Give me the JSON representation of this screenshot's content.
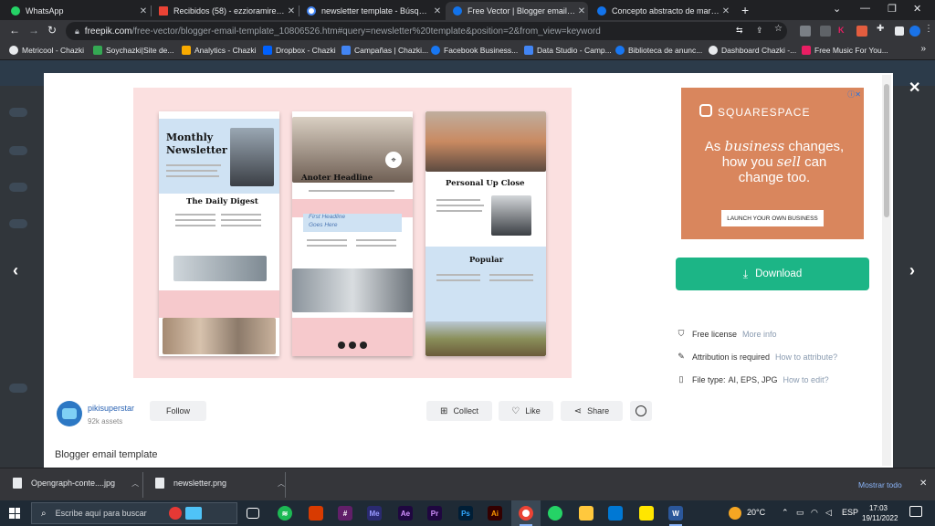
{
  "tabs": [
    {
      "label": "WhatsApp",
      "color": "#25d366"
    },
    {
      "label": "Recibidos (58) - ezzioramireza@g",
      "color": "#ea4335"
    },
    {
      "label": "newsletter template - Búsqueda",
      "color": "#4285f4"
    },
    {
      "label": "Free Vector | Blogger email temp",
      "color": "#1273eb"
    },
    {
      "label": "Concepto abstracto de marketing",
      "color": "#1273eb"
    }
  ],
  "omnibox": {
    "host": "freepik.com",
    "path": "/free-vector/blogger-email-template_10806526.htm#query=newsletter%20template&position=2&from_view=keyword"
  },
  "bookmarks": [
    {
      "label": "Metricool - Chazki",
      "color": "#e8eaed"
    },
    {
      "label": "Soychazki|Site de...",
      "color": "#34a853"
    },
    {
      "label": "Analytics - Chazki",
      "color": "#f9ab00"
    },
    {
      "label": "Dropbox - Chazki",
      "color": "#0061fe"
    },
    {
      "label": "Campañas | Chazki...",
      "color": "#4285f4"
    },
    {
      "label": "Facebook Business...",
      "color": "#1877f2"
    },
    {
      "label": "Data Studio - Camp...",
      "color": "#4285f4"
    },
    {
      "label": "Biblioteca de anunc...",
      "color": "#1877f2"
    },
    {
      "label": "Dashboard Chazki -...",
      "color": "#e8eaed"
    },
    {
      "label": "Free Music For You...",
      "color": "#e91e63"
    }
  ],
  "preview": {
    "panel1": {
      "title1": "Monthly",
      "title2": "Newsletter",
      "section": "The Daily Digest"
    },
    "panel2": {
      "headline": "Anoter Headline",
      "sub1": "First Headline",
      "sub2": "Goes Here"
    },
    "panel3": {
      "heading": "Personal Up Close",
      "section": "Popular"
    }
  },
  "ad": {
    "brand": "SQUARESPACE",
    "line1a": "As ",
    "line1b": "business",
    "line1c": " changes,",
    "line2a": "how you ",
    "line2b": "sell",
    "line2c": " can",
    "line3": "change too.",
    "cta": "LAUNCH YOUR OWN BUSINESS"
  },
  "download_label": "Download",
  "license": {
    "free": "Free license",
    "free_link": "More info",
    "attribution": "Attribution is required",
    "attribution_link": "How to attribute?",
    "filetype_label": "File type:",
    "filetype_value": "AI, EPS, JPG",
    "filetype_link": "How to edit?"
  },
  "author": {
    "name": "pikisuperstar",
    "assets": "92k assets",
    "follow": "Follow"
  },
  "actions": {
    "collect": "Collect",
    "like": "Like",
    "share": "Share"
  },
  "asset_title": "Blogger email template",
  "downloads": [
    {
      "name": "Opengraph-conte....jpg"
    },
    {
      "name": "newsletter.png"
    }
  ],
  "show_all": "Mostrar todo",
  "taskbar": {
    "search_placeholder": "Escribe aquí para buscar",
    "weather": "20°C",
    "lang": "ESP",
    "time": "17:03",
    "date": "19/11/2022"
  }
}
